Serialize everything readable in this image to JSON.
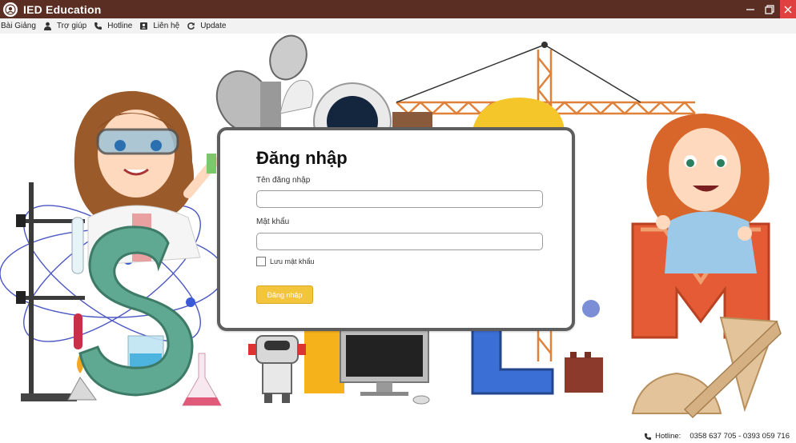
{
  "window": {
    "title": "IED Education",
    "buttons": [
      "minimize",
      "restore",
      "close"
    ]
  },
  "menu": [
    {
      "label": "Bài Giảng",
      "icon": "none"
    },
    {
      "label": "Trợ giúp",
      "icon": "user-icon"
    },
    {
      "label": "Hotline",
      "icon": "phone-icon"
    },
    {
      "label": "Liên hệ",
      "icon": "contact-icon"
    },
    {
      "label": "Update",
      "icon": "refresh-icon"
    }
  ],
  "login": {
    "title": "Đăng nhập",
    "username_label": "Tên đăng nhập",
    "username_value": "",
    "password_label": "Mật khẩu",
    "password_value": "",
    "remember_label": "Lưu mật khẩu",
    "remember_checked": false,
    "submit_label": "Đăng nhập"
  },
  "status": {
    "hotline_label": "Hotline:",
    "hotline_numbers": "0358 637 705 - 0393 059 716"
  },
  "colors": {
    "titlebar": "#5a2e22",
    "close_button": "#e04040",
    "login_button": "#f2c53d",
    "letter_s": "#5fa891",
    "letter_m": "#e45b35"
  }
}
